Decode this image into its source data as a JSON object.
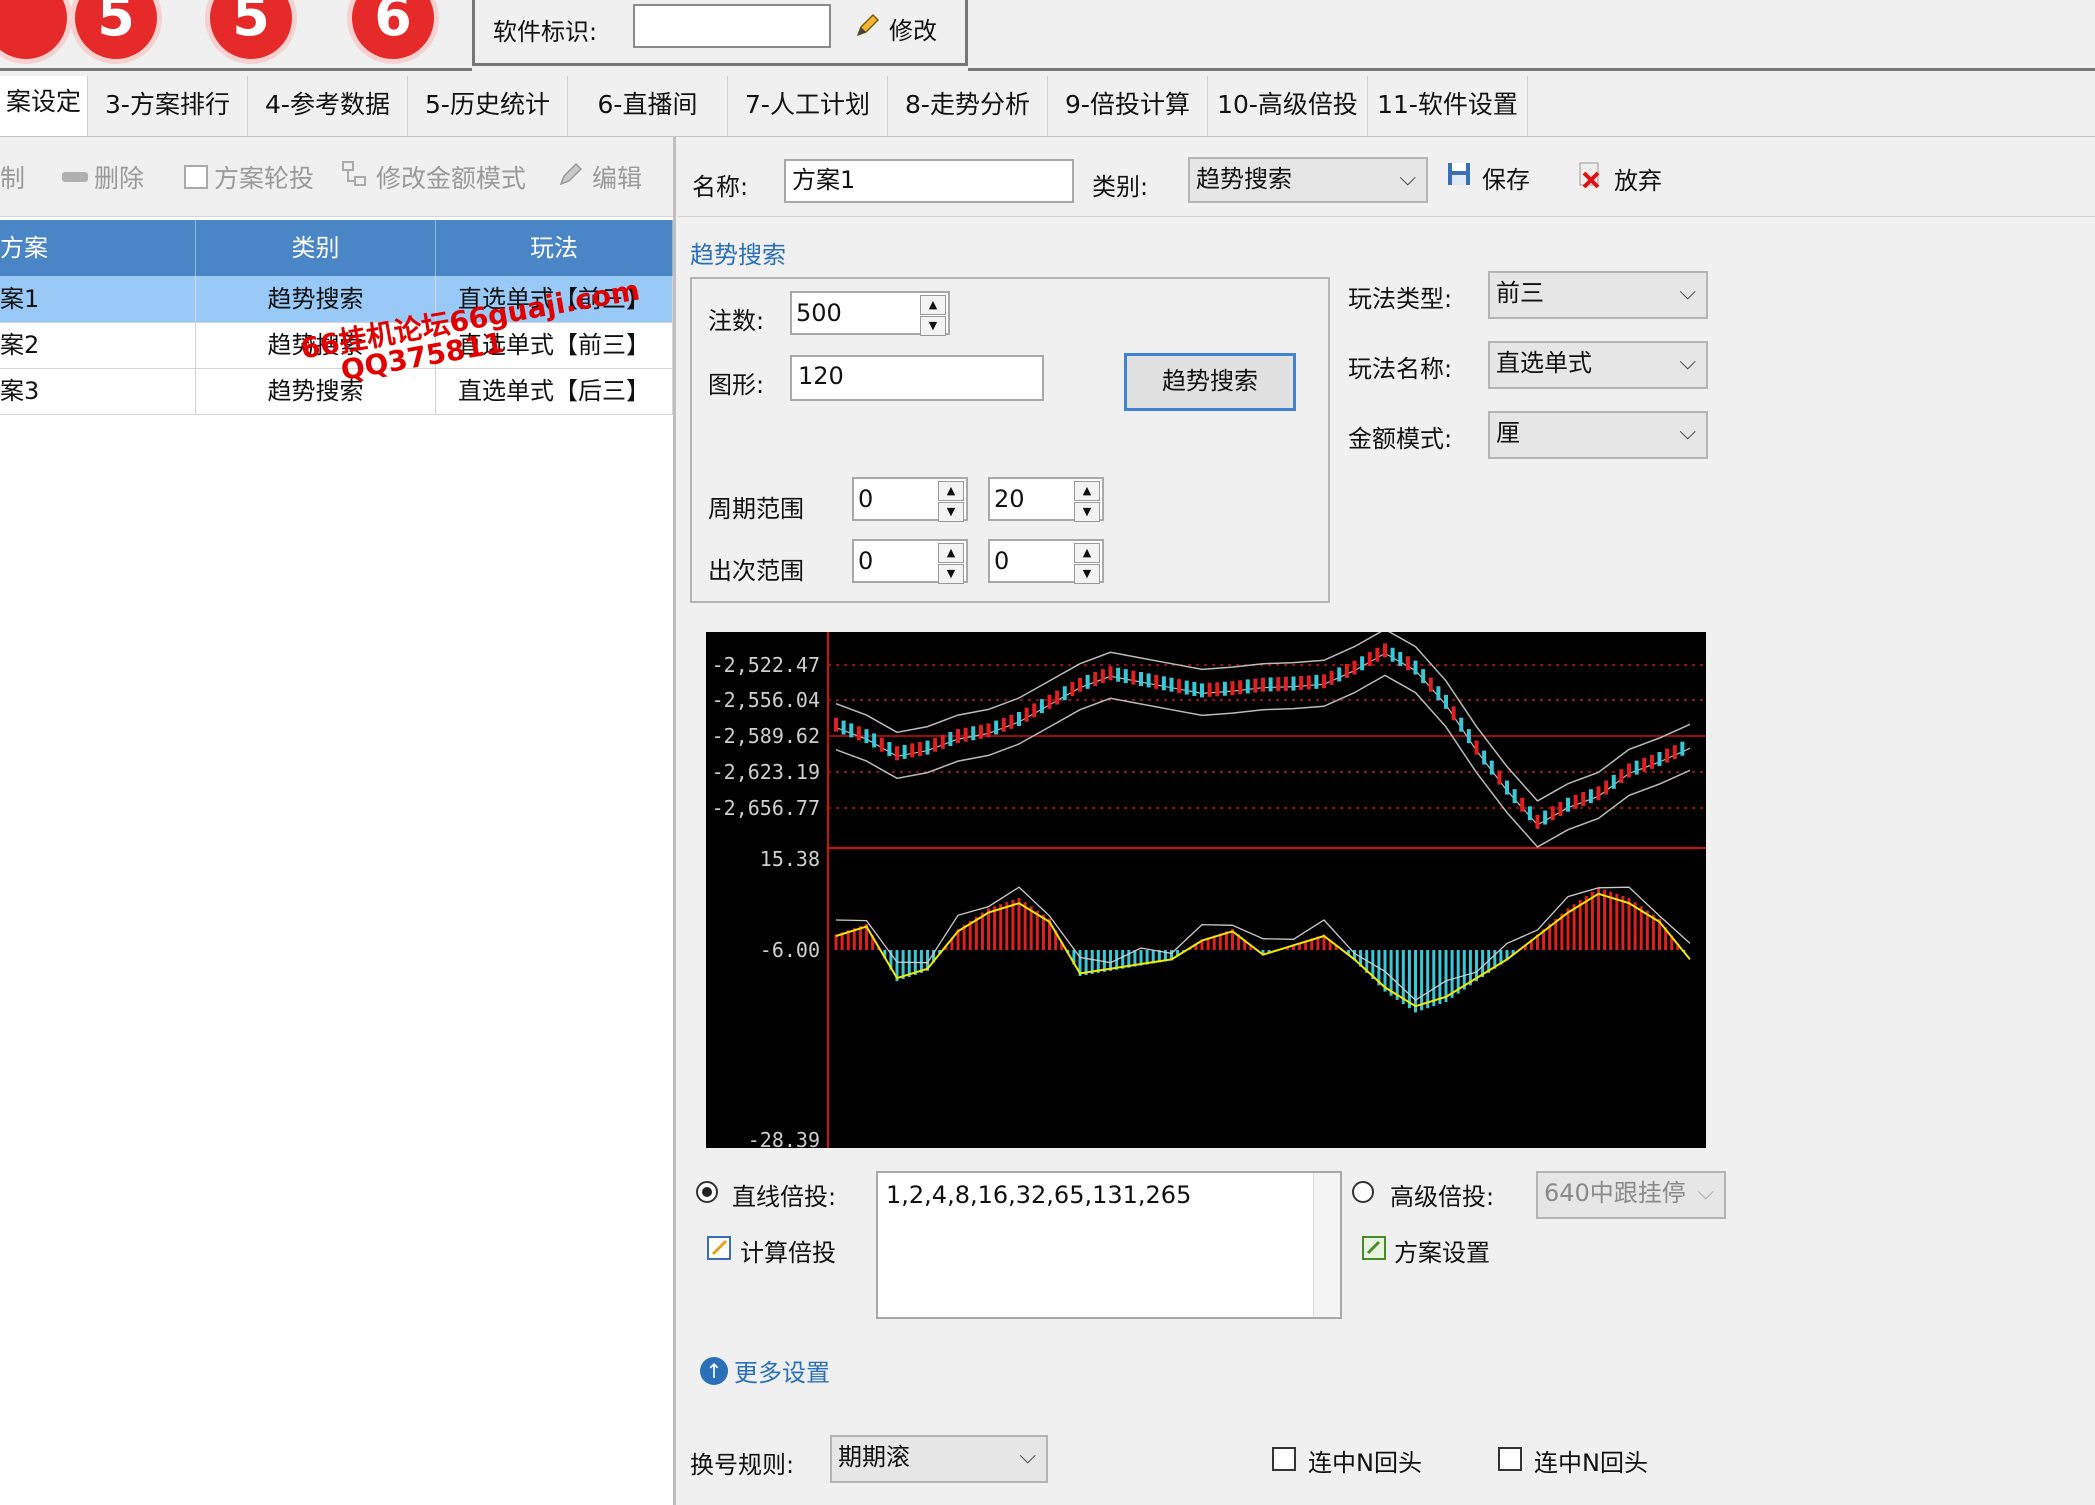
{
  "balls": [
    "5",
    "5",
    "6"
  ],
  "software": {
    "label": "软件标识:",
    "value": "",
    "modify": "修改"
  },
  "tabs": [
    "案设定",
    "3-方案排行",
    "4-参考数据",
    "5-历史统计",
    "6-直播间",
    "7-人工计划",
    "8-走势分析",
    "9-倍投计算",
    "10-高级倍投",
    "11-软件设置"
  ],
  "toolbar": {
    "copy": "制",
    "delete": "删除",
    "rotate": "方案轮投",
    "money_mode": "修改金额模式",
    "edit": "编辑"
  },
  "grid": {
    "headers": [
      "方案",
      "类别",
      "玩法"
    ],
    "rows": [
      {
        "name": "案1",
        "category": "趋势搜索",
        "play": "直选单式【前三】"
      },
      {
        "name": "案2",
        "category": "趋势搜索",
        "play": "直选单式【前三】"
      },
      {
        "name": "案3",
        "category": "趋势搜索",
        "play": "直选单式【后三】"
      }
    ],
    "watermark1": "66挂机论坛66guaji.com",
    "watermark2": "QQ375811"
  },
  "form": {
    "name_label": "名称:",
    "name_value": "方案1",
    "category_label": "类别:",
    "category_value": "趋势搜索",
    "save": "保存",
    "discard": "放弃",
    "section_title": "趋势搜索",
    "bets_label": "注数:",
    "bets_value": "500",
    "shape_label": "图形:",
    "shape_value": "120",
    "search_button": "趋势搜索",
    "period_label": "周期范围",
    "period_from": "0",
    "period_to": "20",
    "hits_label": "出次范围",
    "hits_from": "0",
    "hits_to": "0",
    "play_type_label": "玩法类型:",
    "play_type_value": "前三",
    "play_name_label": "玩法名称:",
    "play_name_value": "直选单式",
    "money_mode_label": "金额模式:",
    "money_mode_value": "厘",
    "linear_label": "直线倍投:",
    "linear_value": "1,2,4,8,16,32,65,131,265",
    "calc_label": "计算倍投",
    "advanced_label": "高级倍投:",
    "advanced_value": "640中跟挂停",
    "scheme_settings": "方案设置",
    "more_settings": "更多设置",
    "switch_rule_label": "换号规则:",
    "switch_rule_value": "期期滚",
    "consecutive1": "连中N回头",
    "consecutive2": "连中N回头"
  },
  "chart_data": {
    "type": "line",
    "upper_panel": {
      "y_ticks": [
        "-2,522.47",
        "-2,556.04",
        "-2,589.62",
        "-2,623.19",
        "-2,656.77"
      ],
      "series": [
        {
          "name": "price",
          "values": [
            -2580,
            -2590,
            -2605,
            -2600,
            -2590,
            -2585,
            -2575,
            -2560,
            -2545,
            -2535,
            -2540,
            -2545,
            -2550,
            -2548,
            -2545,
            -2544,
            -2542,
            -2530,
            -2515,
            -2530,
            -2560,
            -2600,
            -2635,
            -2665,
            -2650,
            -2640,
            -2620,
            -2610,
            -2598
          ]
        }
      ]
    },
    "lower_panel": {
      "y_ticks": [
        "15.38",
        "-6.00",
        "-28.39"
      ],
      "series": [
        {
          "name": "histogram",
          "values": [
            3,
            5,
            -6,
            -4,
            4,
            8,
            10,
            6,
            -5,
            -4,
            -3,
            -2,
            2,
            4,
            -1,
            1,
            3,
            -2,
            -8,
            -12,
            -10,
            -6,
            -2,
            3,
            8,
            12,
            10,
            6,
            -2
          ]
        }
      ]
    }
  }
}
